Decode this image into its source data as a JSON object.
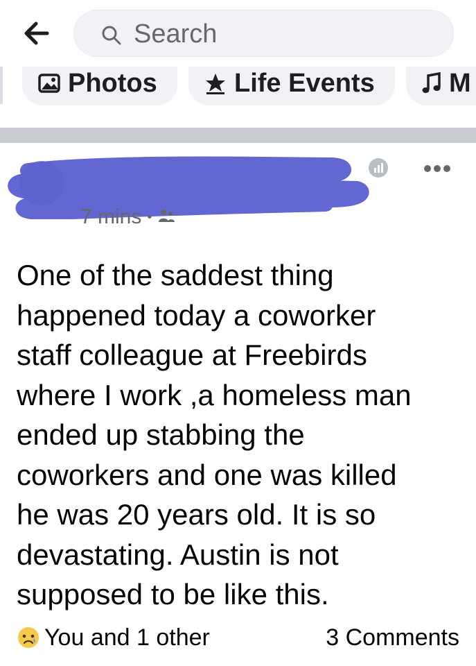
{
  "header": {
    "search_placeholder": "Search"
  },
  "chips": [
    {
      "label": "Photos",
      "icon": "photo-icon"
    },
    {
      "label": "Life Events",
      "icon": "star-icon"
    },
    {
      "label": "M",
      "icon": "music-note-icon"
    }
  ],
  "post": {
    "author_redacted": true,
    "time": "7 mins",
    "audience_icon": "friends-icon",
    "body": "One of the saddest thing\nhappened today a coworker\nstaff colleague at Freebirds\nwhere I work ,a homeless man\nended up stabbing the\ncoworkers and one was killed\nhe was 20 years old. It is so\ndevastating.  Austin is not\nsupposed to be like this.",
    "reaction_icon": "sad-emoji-icon",
    "likes_text": "You and 1 other",
    "comments_text": "3 Comments"
  },
  "colors": {
    "redaction": "#5b5fd0",
    "chip_bg": "#f0f2f5",
    "muted_text": "#65676b"
  }
}
